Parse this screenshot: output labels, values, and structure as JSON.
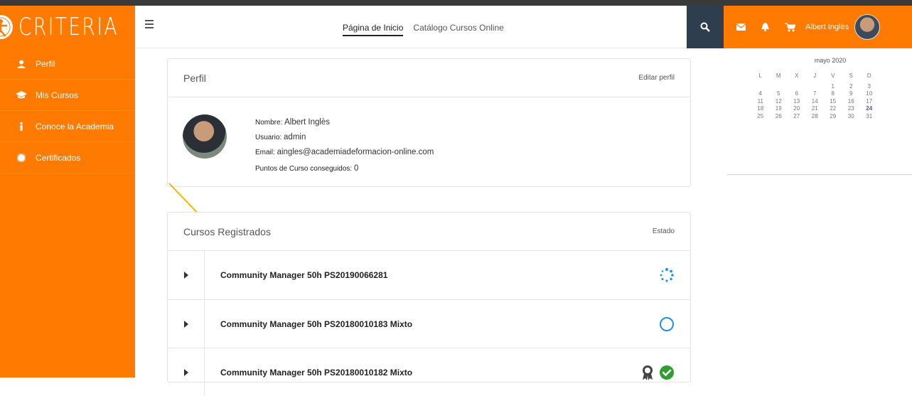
{
  "brand": {
    "name": "CRITERIA"
  },
  "sidebar": {
    "items": [
      {
        "label": "Perfil",
        "icon": "user-icon"
      },
      {
        "label": "Mis Cursos",
        "icon": "graduation-cap-icon"
      },
      {
        "label": "Conoce la Academia",
        "icon": "info-icon"
      },
      {
        "label": "Certificados",
        "icon": "certificate-icon"
      }
    ]
  },
  "header": {
    "tabs": [
      {
        "label": "Página de Inicio",
        "active": true
      },
      {
        "label": "Catálogo Cursos Online",
        "active": false
      }
    ],
    "user_name": "Albert Inglès"
  },
  "profile": {
    "title": "Perfil",
    "edit_link": "Editar perfil",
    "fields": [
      {
        "label": "Nombre:",
        "value": "Albert Inglès"
      },
      {
        "label": "Usuario:",
        "value": "admin"
      },
      {
        "label": "Email:",
        "value": "aingles@academiadeformacion-online.com"
      },
      {
        "label": "Puntos de Curso conseguidos:",
        "value": "0"
      }
    ]
  },
  "courses": {
    "title": "Cursos Registrados",
    "status_header": "Estado",
    "rows": [
      {
        "name": "Community Manager 50h PS20190066281",
        "status": "in-progress"
      },
      {
        "name": "Community Manager 50h PS20180010183 Mixto",
        "status": "not-started"
      },
      {
        "name": "Community Manager 50h PS20180010182 Mixto",
        "status": "completed"
      }
    ]
  },
  "calendar": {
    "title": "mayo 2020",
    "weekdays": [
      "L",
      "M",
      "X",
      "J",
      "V",
      "S",
      "D"
    ],
    "weeks": [
      [
        "",
        "",
        "",
        "",
        "1",
        "2",
        "3"
      ],
      [
        "4",
        "5",
        "6",
        "7",
        "8",
        "9",
        "10"
      ],
      [
        "11",
        "12",
        "13",
        "14",
        "15",
        "16",
        "17"
      ],
      [
        "18",
        "19",
        "20",
        "21",
        "22",
        "23",
        "24"
      ],
      [
        "25",
        "26",
        "27",
        "28",
        "29",
        "30",
        "31"
      ]
    ],
    "today": "24"
  },
  "colors": {
    "accent": "#ff7a00",
    "dark": "#2f3e4e",
    "progress_blue": "#1e90e8",
    "complete_green": "#2e9e2e"
  }
}
